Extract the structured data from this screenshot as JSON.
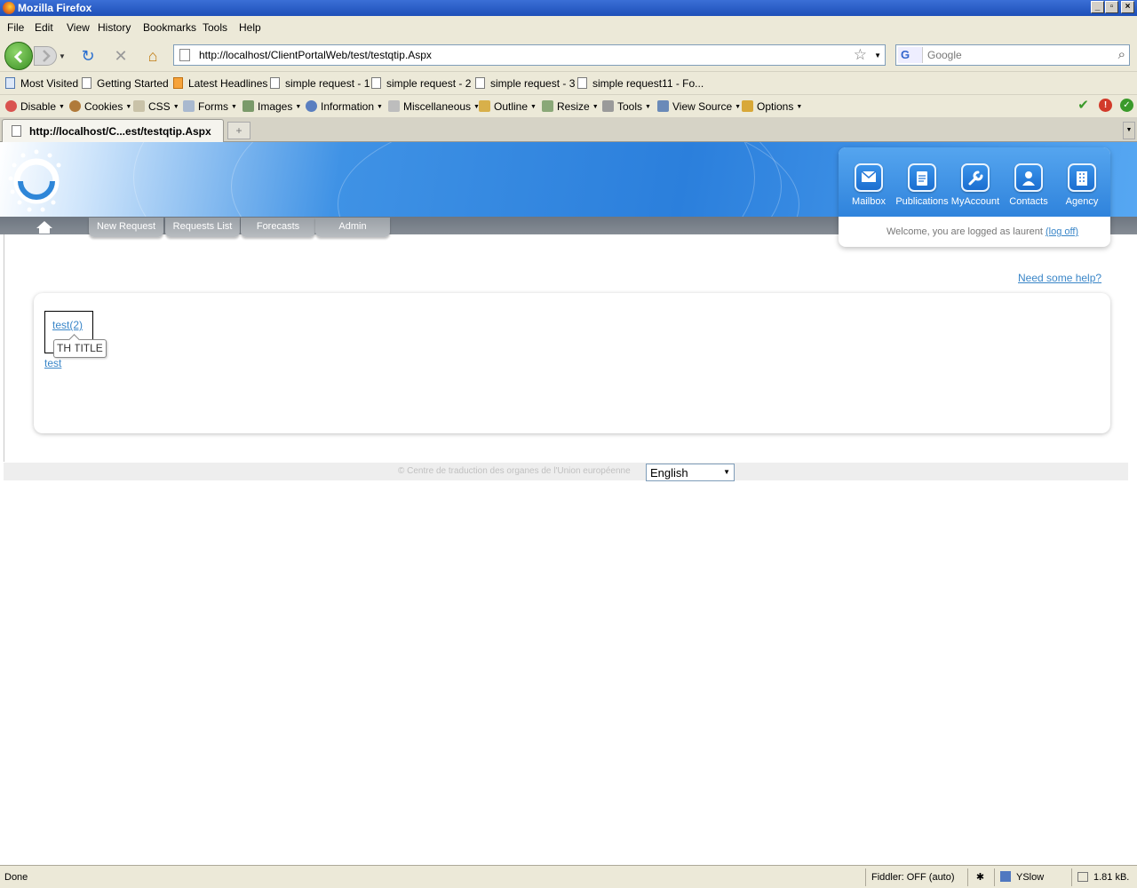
{
  "window": {
    "title": "Mozilla Firefox"
  },
  "menu": [
    "File",
    "Edit",
    "View",
    "History",
    "Bookmarks",
    "Tools",
    "Help"
  ],
  "navigation": {
    "url": "http://localhost/ClientPortalWeb/test/testqtip.Aspx",
    "search_placeholder": "Google"
  },
  "bookmarks": [
    "Most Visited",
    "Getting Started",
    "Latest Headlines",
    "simple request - 1",
    "simple request - 2",
    "simple request - 3",
    "simple request11 - Fo..."
  ],
  "devtoolbar": [
    "Disable",
    "Cookies",
    "CSS",
    "Forms",
    "Images",
    "Information",
    "Miscellaneous",
    "Outline",
    "Resize",
    "Tools",
    "View Source",
    "Options"
  ],
  "tab": {
    "title": "http://localhost/C...est/testqtip.Aspx"
  },
  "site": {
    "nav_tabs": [
      "New Request",
      "Requests List",
      "Forecasts",
      "Admin"
    ],
    "quick_icons": [
      "Mailbox",
      "Publications",
      "MyAccount",
      "Contacts",
      "Agency"
    ],
    "welcome_text": "Welcome, you are logged as laurent",
    "logoff": "(log off)",
    "help_link": "Need some help?",
    "link1": "test(2)",
    "tooltip": "TH TITLE",
    "link2": "test",
    "copyright": "© Centre de traduction des organes de l'Union européenne",
    "language": "English"
  },
  "statusbar": {
    "status": "Done",
    "fiddler": "Fiddler: OFF (auto)",
    "yslow": "YSlow",
    "size": "1.81 kB."
  }
}
